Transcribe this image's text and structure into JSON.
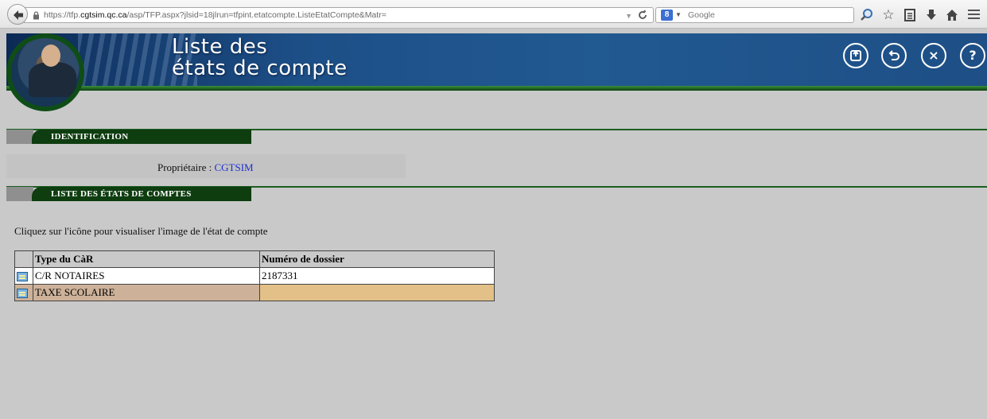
{
  "browser": {
    "url_prefix": "https://tfp.",
    "url_host": "cgtsim.qc.ca",
    "url_path": "/asp/TFP.aspx?jlsid=18jlrun=tfpint.etatcompte.ListeEtatCompte&Matr=",
    "search_placeholder": "Google",
    "search_engine_letter": "8"
  },
  "header": {
    "title_line1": "Liste des",
    "title_line2": "états de compte",
    "nav_icons": [
      "home-icon",
      "back-icon",
      "close-icon",
      "help-icon"
    ]
  },
  "identification": {
    "heading": "IDENTIFICATION",
    "owner_label": "Propriétaire :",
    "owner_value": "CGTSIM"
  },
  "statements": {
    "heading": "LISTE DES ÉTATS DE COMPTES",
    "instruction": "Cliquez sur l'icône pour visualiser l'image de l'état de compte",
    "columns": [
      "Type du CàR",
      "Numéro de dossier"
    ],
    "rows": [
      {
        "type": "C/R NOTAIRES",
        "number": "2187331"
      },
      {
        "type": "TAXE SCOLAIRE",
        "number": ""
      }
    ]
  },
  "colors": {
    "banner_blue": "#1d4f87",
    "section_green": "#0e3d10",
    "link_blue": "#1d2ed0"
  }
}
